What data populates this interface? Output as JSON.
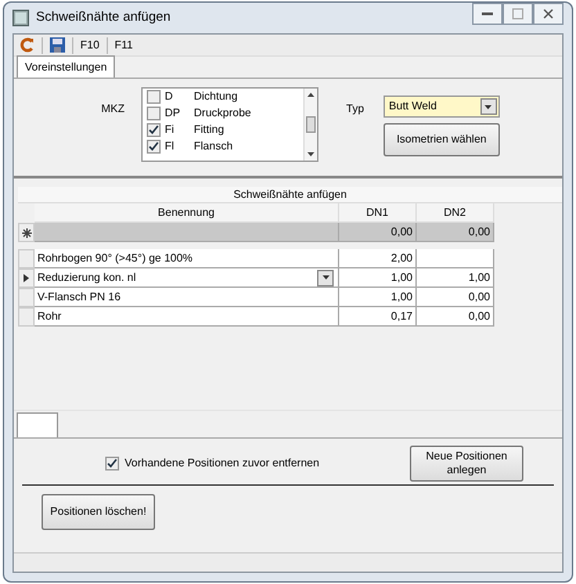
{
  "window": {
    "title": "Schweißnähte anfügen"
  },
  "toolbar": [
    {
      "kind": "refresh"
    },
    {
      "kind": "save"
    },
    {
      "kind": "text",
      "label": "F10"
    },
    {
      "kind": "text",
      "label": "F11"
    }
  ],
  "tabs": [
    {
      "label": "Voreinstellungen",
      "selected": true
    }
  ],
  "settings": {
    "mkz_label": "MKZ",
    "mkz_items": [
      {
        "code": "D",
        "name": "Dichtung",
        "checked": false
      },
      {
        "code": "DP",
        "name": "Druckprobe",
        "checked": false
      },
      {
        "code": "Fi",
        "name": "Fitting",
        "checked": true
      },
      {
        "code": "Fl",
        "name": "Flansch",
        "checked": true
      }
    ],
    "typ_label": "Typ",
    "typ_value": "Butt Weld",
    "button": "Isometrien wählen"
  },
  "grid": {
    "title": "Schweißnähte anfügen",
    "columns": [
      "Benennung",
      "DN1",
      "DN2"
    ],
    "new_row": {
      "dn1": "0,00",
      "dn2": "0,00"
    },
    "rows": [
      {
        "benennung": "Rohrbogen 90° (>45°) ge 100%",
        "dn1": "2,00",
        "dn2": "",
        "current": false,
        "dropdown": false
      },
      {
        "benennung": "Reduzierung kon. nl",
        "dn1": "1,00",
        "dn2": "1,00",
        "current": true,
        "dropdown": true
      },
      {
        "benennung": "V-Flansch PN 16",
        "dn1": "1,00",
        "dn2": "0,00",
        "current": false,
        "dropdown": false
      },
      {
        "benennung": "Rohr",
        "dn1": "0,17",
        "dn2": "0,00",
        "current": false,
        "dropdown": false
      }
    ]
  },
  "options": {
    "remove_existing": {
      "label": "Vorhandene Positionen zuvor entfernen",
      "checked": true
    },
    "create_button": "Neue Positionen anlegen",
    "delete_button": "Positionen löschen!"
  }
}
